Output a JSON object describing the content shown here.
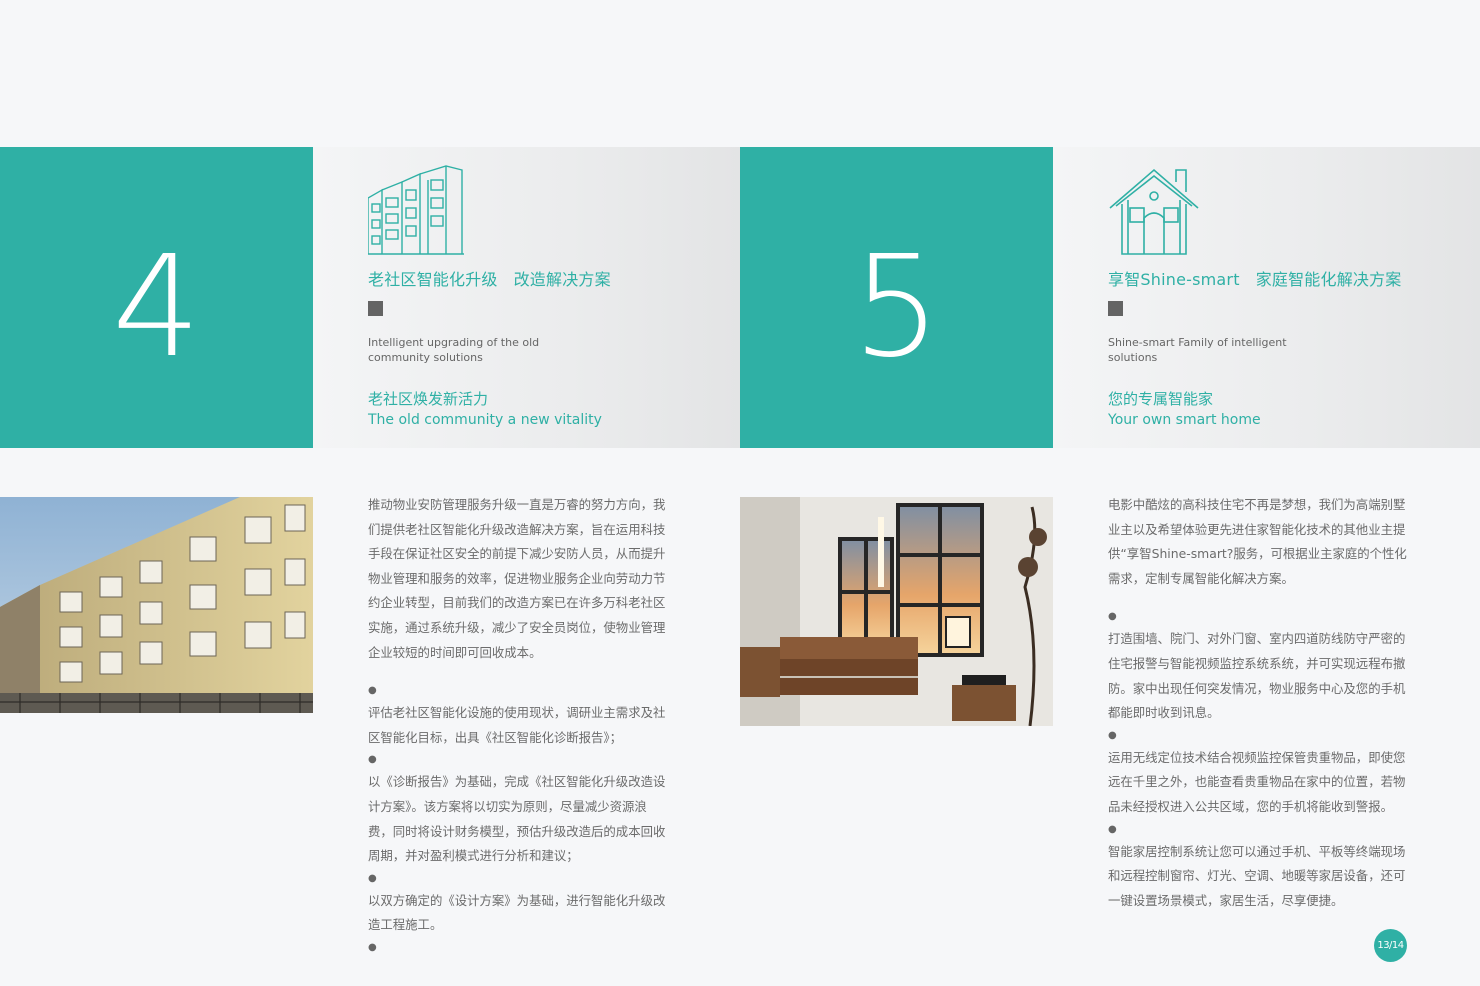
{
  "section1": {
    "number": "4",
    "title_part1": "老社区智能化升级",
    "title_part2": "改造解决方案",
    "en_desc": "Intelligent upgrading of the old community solutions",
    "sub_zh": "老社区焕发新活力",
    "sub_en": "The old community a new vitality",
    "icon": "building-icon",
    "body": [
      "推动物业安防管理服务升级一直是万睿的努力方向，我们提供老社区智能化升级改造解决方案，旨在运用科技手段在保证社区安全的前提下减少安防人员，从而提升物业管理和服务的效率，促进物业服务企业向劳动力节约企业转型，目前我们的改造方案已在许多万科老社区实施，通过系统升级，减少了安全员岗位，使物业管理企业较短的时间即可回收成本。"
    ],
    "bullet_char": "●",
    "bullets": [
      "评估老社区智能化设施的使用现状，调研业主需求及社区智能化目标，出具《社区智能化诊断报告》；",
      "以《诊断报告》为基础，完成《社区智能化升级改造设计方案》。该方案将以切实为原则，尽量减少资源浪费，同时将设计财务模型，预估升级改造后的成本回收周期，并对盈利模式进行分析和建议；",
      "以双方确定的《设计方案》为基础，进行智能化升级改造工程施工。"
    ]
  },
  "section2": {
    "number": "5",
    "title_part1": "享智Shine-smart",
    "title_part2": "家庭智能化解决方案",
    "en_desc": "Shine-smart Family of intelligent solutions",
    "sub_zh": "您的专属智能家",
    "sub_en": "Your own smart home",
    "icon": "house-icon",
    "body": [
      "电影中酷炫的高科技住宅不再是梦想，我们为高端别墅业主以及希望体验更先进住家智能化技术的其他业主提供“享智Shine-smart?服务，可根据业主家庭的个性化需求，定制专属智能化解决方案。"
    ],
    "bullet_char": "●",
    "bullets": [
      "打造围墙、院门、对外门窗、室内四道防线防守严密的住宅报警与智能视频监控系统系统，并可实现远程布撤防。家中出现任何突发情况，物业服务中心及您的手机都能即时收到讯息。",
      "运用无线定位技术结合视频监控保管贵重物品，即使您远在千里之外，也能查看贵重物品在家中的位置，若物品未经授权进入公共区域，您的手机将能收到警报。",
      "智能家居控制系统让您可以通过手机、平板等终端现场和远程控制窗帘、灯光、空调、地暖等家居设备，还可一键设置场景模式，家居生活，尽享便捷。"
    ]
  },
  "page_badge": "13/14",
  "colors": {
    "accent": "#2fb0a5",
    "text": "#6b6b6b",
    "square": "#646464"
  }
}
